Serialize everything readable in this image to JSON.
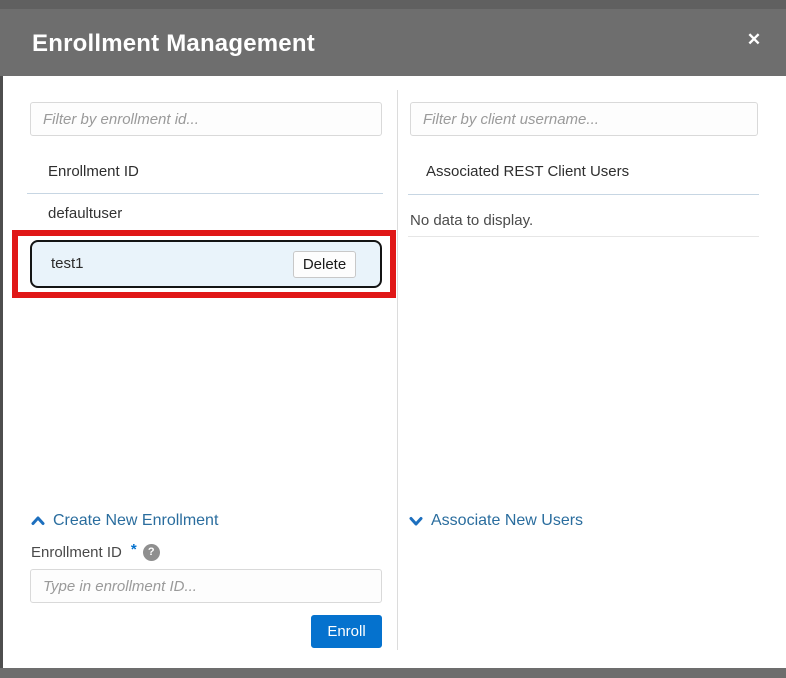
{
  "dialog": {
    "title": "Enrollment Management",
    "close_icon": "✕"
  },
  "left_panel": {
    "filter_placeholder": "Filter by enrollment id...",
    "column_header": "Enrollment ID",
    "rows": [
      {
        "id": "defaultuser",
        "selected": false
      },
      {
        "id": "test1",
        "selected": true,
        "action_label": "Delete"
      }
    ],
    "create_section": {
      "toggle_label": "Create New Enrollment",
      "field_label": "Enrollment ID",
      "required_marker": "*",
      "help_icon": "?",
      "input_placeholder": "Type in enrollment ID...",
      "submit_label": "Enroll"
    }
  },
  "right_panel": {
    "filter_placeholder": "Filter by client username...",
    "column_header": "Associated REST Client Users",
    "empty_message": "No data to display.",
    "associate_toggle_label": "Associate New Users"
  },
  "annotation": {
    "type": "highlight-rectangle",
    "color": "#e01717",
    "target_row": "test1"
  },
  "colors": {
    "header_gray": "#6e6e6e",
    "accent_blue": "#0572ce",
    "link_blue": "#2a6d9e",
    "selected_row_bg": "#e9f3fa",
    "annotation_red": "#e01717"
  }
}
